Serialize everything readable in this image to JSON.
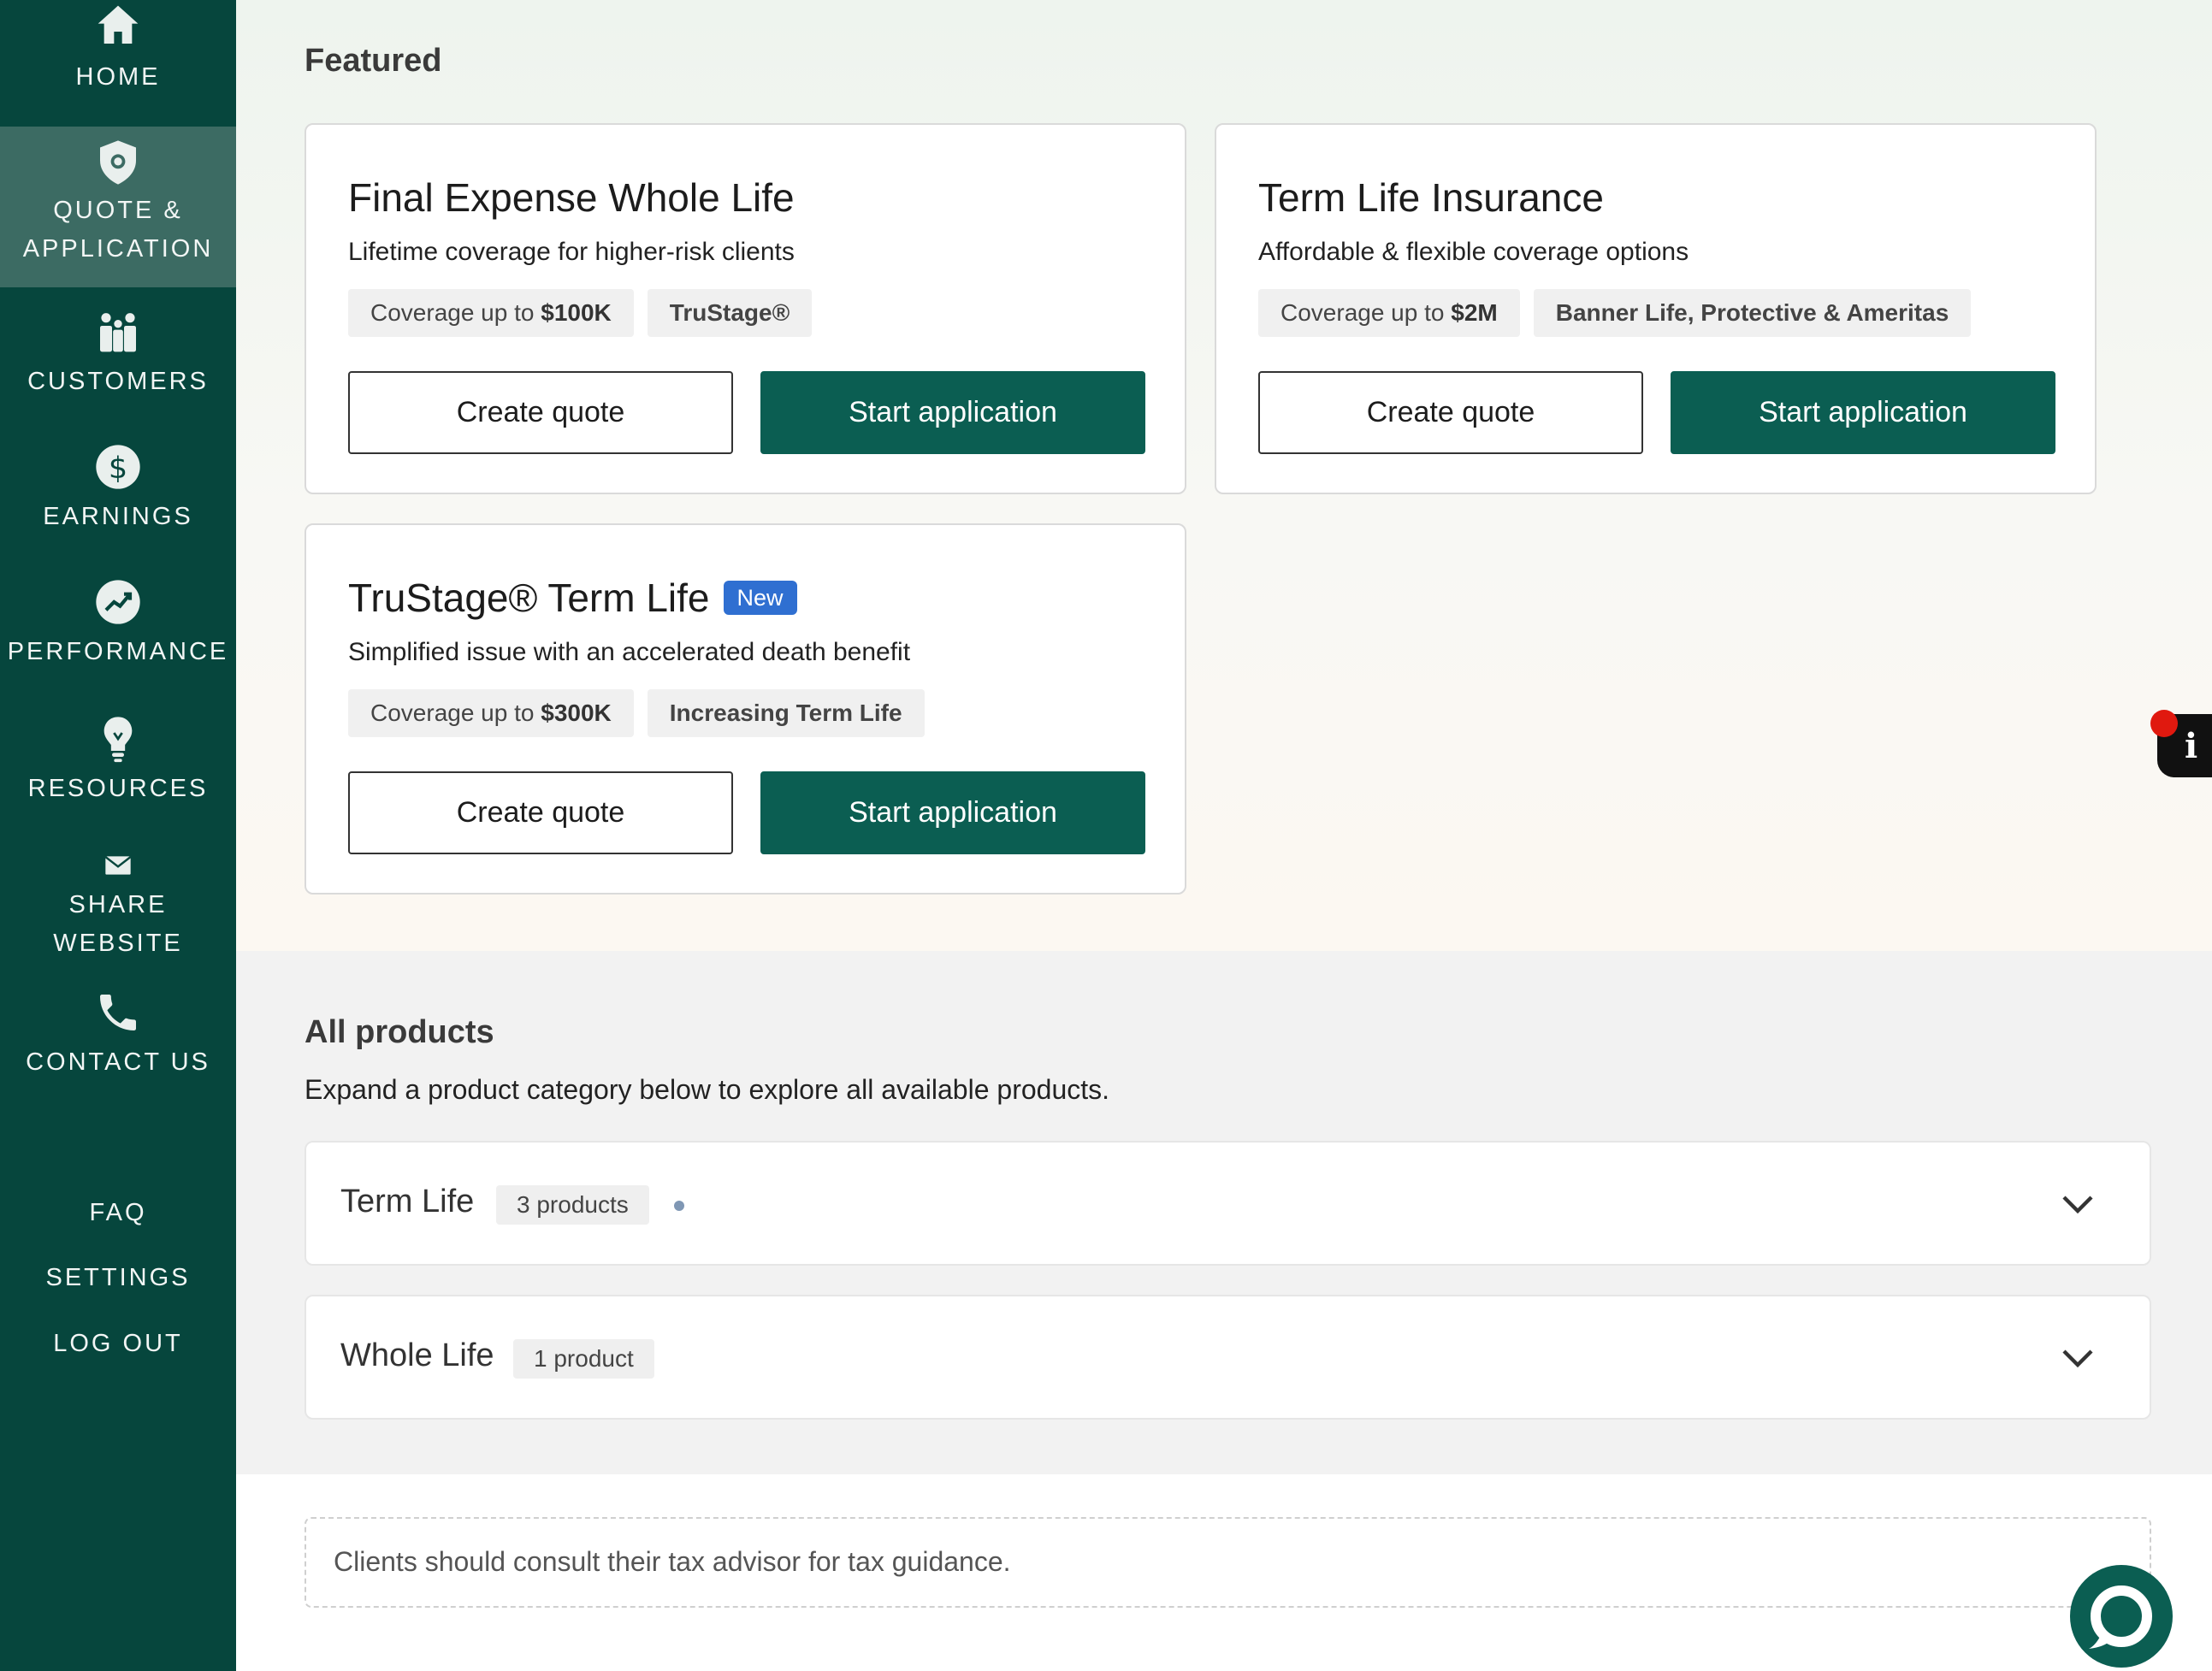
{
  "sidebar": {
    "items": [
      {
        "label": "HOME",
        "icon": "home-icon",
        "active": false
      },
      {
        "label": "QUOTE &\nAPPLICATION",
        "icon": "shield-icon",
        "active": true
      },
      {
        "label": "CUSTOMERS",
        "icon": "people-icon",
        "active": false
      },
      {
        "label": "EARNINGS",
        "icon": "dollar-icon",
        "active": false
      },
      {
        "label": "PERFORMANCE",
        "icon": "trend-up-icon",
        "active": false
      },
      {
        "label": "RESOURCES",
        "icon": "lightbulb-icon",
        "active": false
      },
      {
        "label": "SHARE WEBSITE",
        "icon": "envelope-icon",
        "active": false
      },
      {
        "label": "CONTACT US",
        "icon": "phone-icon",
        "active": false
      }
    ],
    "bottom_links": [
      "FAQ",
      "SETTINGS",
      "LOG OUT"
    ]
  },
  "featured": {
    "title": "Featured",
    "cards": [
      {
        "title": "Final Expense Whole Life",
        "badge": "",
        "description": "Lifetime coverage for higher-risk clients",
        "coverage_prefix": "Coverage up to ",
        "coverage_amount": "$100K",
        "carrier_tag": "TruStage®",
        "create_quote_label": "Create quote",
        "start_application_label": "Start application"
      },
      {
        "title": "Term Life Insurance",
        "badge": "",
        "description": "Affordable & flexible coverage options",
        "coverage_prefix": "Coverage up to ",
        "coverage_amount": "$2M",
        "carrier_tag": "Banner Life, Protective & Ameritas",
        "create_quote_label": "Create quote",
        "start_application_label": "Start application"
      },
      {
        "title": "TruStage® Term Life",
        "badge": "New",
        "description": "Simplified issue with an accelerated death benefit",
        "coverage_prefix": "Coverage up to ",
        "coverage_amount": "$300K",
        "carrier_tag": "Increasing Term Life",
        "create_quote_label": "Create quote",
        "start_application_label": "Start application"
      }
    ]
  },
  "all_products": {
    "title": "All products",
    "subtitle": "Expand a product category below to explore all available products.",
    "categories": [
      {
        "label": "Term Life",
        "count": "3 products"
      },
      {
        "label": "Whole Life",
        "count": "1 product"
      }
    ]
  },
  "footer": {
    "disclaimer": "Clients should consult their tax advisor for tax guidance."
  },
  "colors": {
    "sidebar": "#06463d",
    "sidebar_active": "#3c6b63",
    "primary_button": "#0b5e52",
    "badge_new": "#2f6fd1",
    "notification_dot": "#e0190f"
  }
}
